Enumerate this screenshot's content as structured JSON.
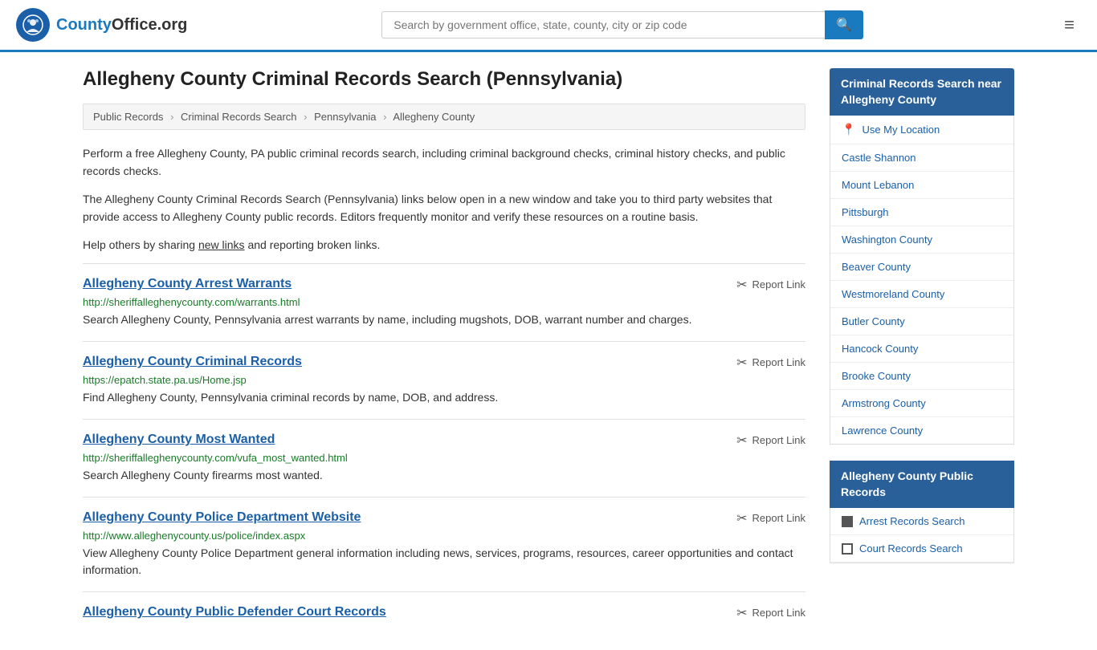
{
  "header": {
    "logo_text": "County",
    "logo_suffix": "Office.org",
    "search_placeholder": "Search by government office, state, county, city or zip code",
    "menu_icon": "≡"
  },
  "page": {
    "title": "Allegheny County Criminal Records Search (Pennsylvania)",
    "breadcrumb": [
      {
        "label": "Public Records",
        "href": "#"
      },
      {
        "label": "Criminal Records Search",
        "href": "#"
      },
      {
        "label": "Pennsylvania",
        "href": "#"
      },
      {
        "label": "Allegheny County",
        "href": "#"
      }
    ],
    "description1": "Perform a free Allegheny County, PA public criminal records search, including criminal background checks, criminal history checks, and public records checks.",
    "description2": "The Allegheny County Criminal Records Search (Pennsylvania) links below open in a new window and take you to third party websites that provide access to Allegheny County public records. Editors frequently monitor and verify these resources on a routine basis.",
    "description3_prefix": "Help others by sharing ",
    "new_links_text": "new links",
    "description3_suffix": " and reporting broken links.",
    "results": [
      {
        "title": "Allegheny County Arrest Warrants",
        "url": "http://sheriffalleghenycounty.com/warrants.html",
        "description": "Search Allegheny County, Pennsylvania arrest warrants by name, including mugshots, DOB, warrant number and charges.",
        "report_label": "Report Link"
      },
      {
        "title": "Allegheny County Criminal Records",
        "url": "https://epatch.state.pa.us/Home.jsp",
        "description": "Find Allegheny County, Pennsylvania criminal records by name, DOB, and address.",
        "report_label": "Report Link"
      },
      {
        "title": "Allegheny County Most Wanted",
        "url": "http://sheriffalleghenycounty.com/vufa_most_wanted.html",
        "description": "Search Allegheny County firearms most wanted.",
        "report_label": "Report Link"
      },
      {
        "title": "Allegheny County Police Department Website",
        "url": "http://www.alleghenycounty.us/police/index.aspx",
        "description": "View Allegheny County Police Department general information including news, services, programs, resources, career opportunities and contact information.",
        "report_label": "Report Link"
      },
      {
        "title": "Allegheny County Public Defender Court Records",
        "url": "",
        "description": "",
        "report_label": "Report Link"
      }
    ]
  },
  "sidebar": {
    "nearby_title": "Criminal Records Search near Allegheny County",
    "use_my_location": "Use My Location",
    "nearby_items": [
      {
        "label": "Castle Shannon"
      },
      {
        "label": "Mount Lebanon"
      },
      {
        "label": "Pittsburgh"
      },
      {
        "label": "Washington County"
      },
      {
        "label": "Beaver County"
      },
      {
        "label": "Westmoreland County"
      },
      {
        "label": "Butler County"
      },
      {
        "label": "Hancock County"
      },
      {
        "label": "Brooke County"
      },
      {
        "label": "Armstrong County"
      },
      {
        "label": "Lawrence County"
      }
    ],
    "public_records_title": "Allegheny County Public Records",
    "public_records_items": [
      {
        "label": "Arrest Records Search",
        "icon": "filled"
      },
      {
        "label": "Court Records Search",
        "icon": "outline"
      }
    ]
  }
}
